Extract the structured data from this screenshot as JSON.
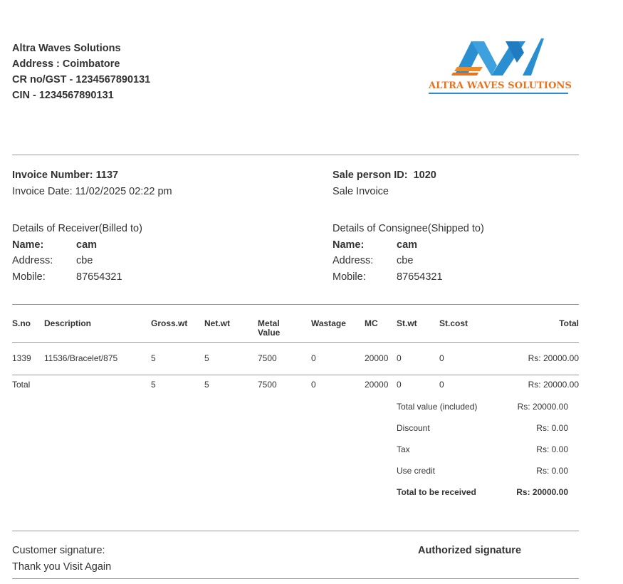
{
  "company": {
    "name": "Altra Waves Solutions",
    "address": "Address : Coimbatore",
    "gst": "CR no/GST - 1234567890131",
    "cin": "CIN - 1234567890131",
    "logo_text": "ALTRA WAVES SOLUTIONS",
    "colors": {
      "logo_blue": "#2a8fd0",
      "logo_orange": "#e6731f"
    }
  },
  "invoice": {
    "number": "Invoice Number: 1137",
    "date": "Invoice Date: 11/02/2025 02:22 pm",
    "sale_person": "Sale person ID:  1020",
    "type": "Sale Invoice"
  },
  "receiver": {
    "heading": "Details of Receiver(Billed to)",
    "name_label": "Name:",
    "name": "cam",
    "address_label": "Address:",
    "address": "cbe",
    "mobile_label": "Mobile:",
    "mobile": "87654321"
  },
  "consignee": {
    "heading": "Details of Consignee(Shipped to)",
    "name_label": "Name:",
    "name": "cam",
    "address_label": "Address:",
    "address": "cbe",
    "mobile_label": "Mobile:",
    "mobile": "87654321"
  },
  "table": {
    "headers": {
      "sno": "S.no",
      "description": "Description",
      "gross": "Gross.wt",
      "net": "Net.wt",
      "metal_1": "Metal",
      "metal_2": "Value",
      "wastage": "Wastage",
      "mc": "MC",
      "stwt": "St.wt",
      "stcost": "St.cost",
      "total": "Total"
    },
    "row": {
      "sno": "1339",
      "description": "11536/Bracelet/875",
      "gross": "5",
      "net": "5",
      "metal": "7500",
      "wastage": "0",
      "mc": "20000",
      "stwt": "0",
      "stcost": "0",
      "total": "Rs: 20000.00"
    },
    "totals": {
      "label": "Total",
      "gross": "5",
      "net": "5",
      "metal": "7500",
      "wastage": "0",
      "mc": "20000",
      "stwt": "0",
      "stcost": "0",
      "total": "Rs: 20000.00"
    }
  },
  "summary": {
    "total_value_label": "Total value (included)",
    "total_value": "Rs: 20000.00",
    "discount_label": "Discount",
    "discount": "Rs: 0.00",
    "tax_label": "Tax",
    "tax": "Rs: 0.00",
    "credit_label": "Use credit",
    "credit": "Rs: 0.00",
    "receive_label": "Total to be received",
    "receive": "Rs: 20000.00"
  },
  "footer": {
    "customer_signature": "Customer signature:",
    "thanks": "Thank you Visit Again",
    "authorized": "Authorized signature"
  }
}
